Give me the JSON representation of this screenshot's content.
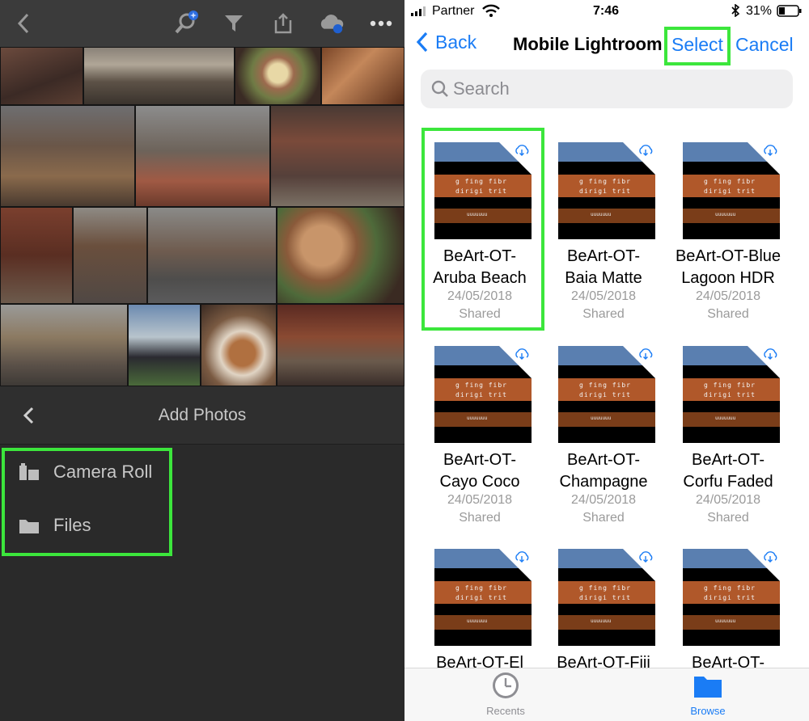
{
  "left_pane": {
    "add_photos": {
      "title": "Add Photos",
      "sources": [
        {
          "label": "Camera Roll",
          "icon": "camera-roll-icon"
        },
        {
          "label": "Files",
          "icon": "folder-icon"
        }
      ]
    },
    "toolbar_icons": [
      "back-icon",
      "search-sparkle-icon",
      "filter-icon",
      "share-icon",
      "cloud-sync-icon",
      "more-icon"
    ],
    "colors": {
      "background": "#2a2a2a",
      "highlight": "#3ce63c"
    }
  },
  "status_bar": {
    "carrier": "Partner",
    "time": "7:46",
    "battery": "31%"
  },
  "nav": {
    "back_label": "Back",
    "title": "Mobile Lightroom",
    "select_label": "Select",
    "cancel_label": "Cancel"
  },
  "search": {
    "placeholder": "Search"
  },
  "files": [
    {
      "name_line1": "BeArt-OT-",
      "name_line2": "Aruba Beach",
      "date": "24/05/2018",
      "status": "Shared"
    },
    {
      "name_line1": "BeArt-OT-",
      "name_line2": "Baia Matte",
      "date": "24/05/2018",
      "status": "Shared"
    },
    {
      "name_line1": "BeArt-OT-Blue",
      "name_line2": "Lagoon HDR",
      "date": "24/05/2018",
      "status": "Shared"
    },
    {
      "name_line1": "BeArt-OT-",
      "name_line2": "Cayo Coco",
      "date": "24/05/2018",
      "status": "Shared"
    },
    {
      "name_line1": "BeArt-OT-",
      "name_line2": "Champagne",
      "date": "24/05/2018",
      "status": "Shared"
    },
    {
      "name_line1": "BeArt-OT-",
      "name_line2": "Corfu Faded",
      "date": "24/05/2018",
      "status": "Shared"
    },
    {
      "name_line1": "BeArt-OT-El",
      "name_line2": "",
      "date": "",
      "status": ""
    },
    {
      "name_line1": "BeArt-OT-Fiji",
      "name_line2": "",
      "date": "",
      "status": ""
    },
    {
      "name_line1": "BeArt-OT-",
      "name_line2": "",
      "date": "",
      "status": ""
    }
  ],
  "thumbnail_text": {
    "line1": "g fing fibr",
    "line2": "dirigi trit",
    "line3": "uuuuuuu"
  },
  "tabbar": {
    "tabs": [
      {
        "label": "Recents",
        "icon": "clock-icon",
        "active": false
      },
      {
        "label": "Browse",
        "icon": "folder-icon",
        "active": true
      }
    ]
  },
  "colors": {
    "ios_blue": "#1a7cf5",
    "highlight": "#3ce63c"
  }
}
